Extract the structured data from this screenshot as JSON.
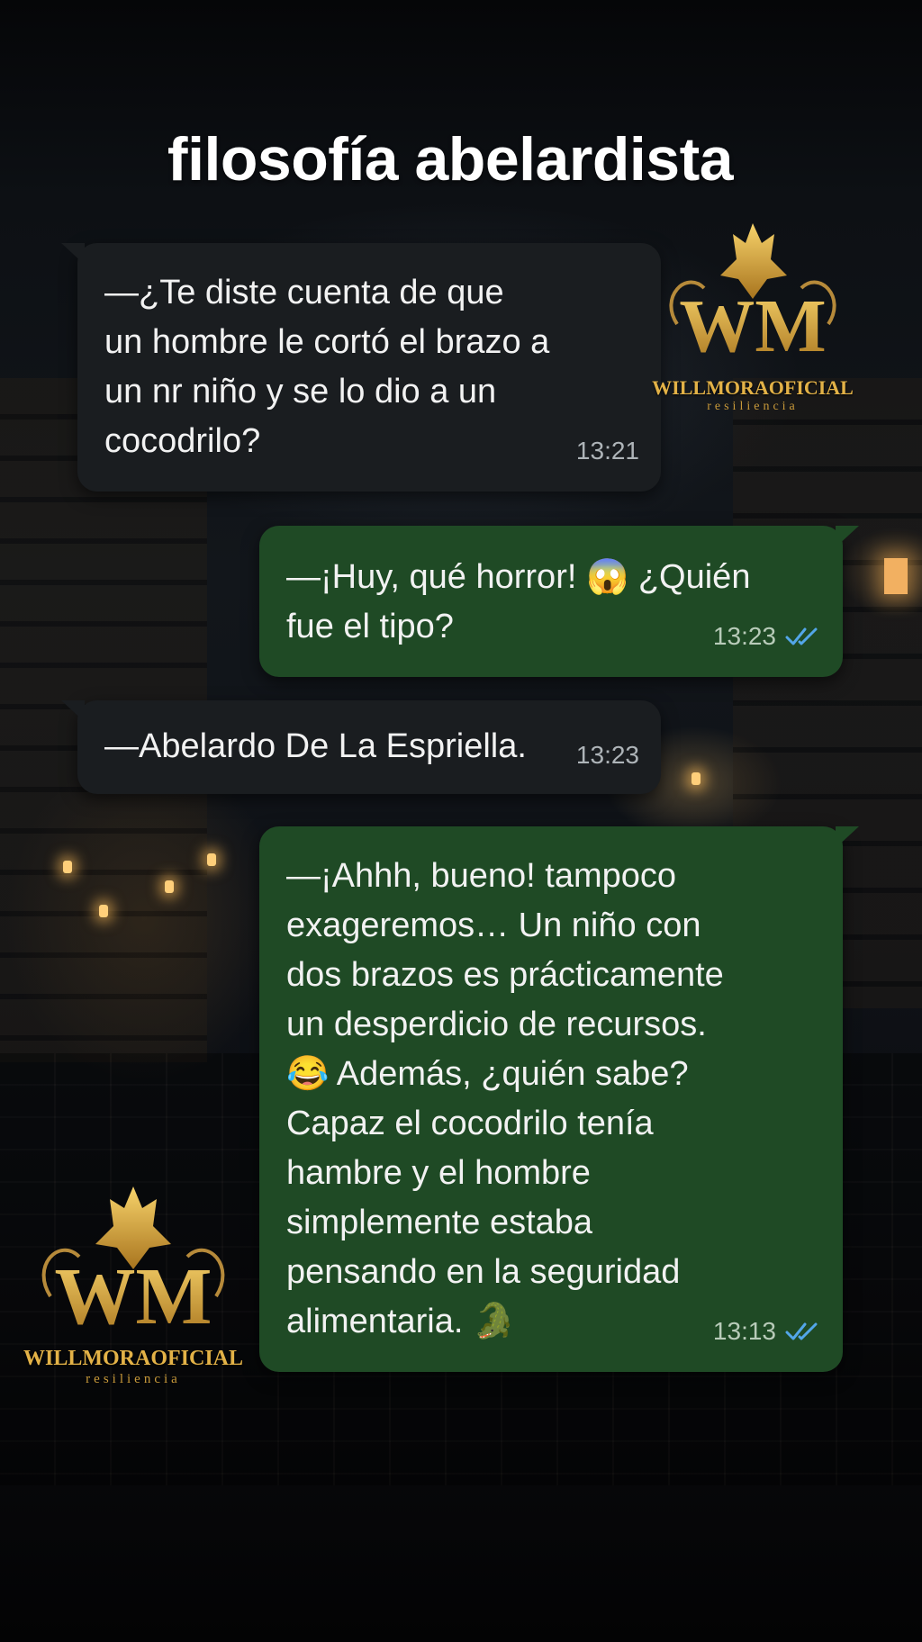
{
  "title": "filosofía abelardista",
  "messages": [
    {
      "direction": "incoming",
      "text": "—¿Te diste cuenta de que\nun hombre le cortó el brazo a\nun nr niño y se lo dio a un\ncocodrilo?",
      "time": "13:21"
    },
    {
      "direction": "outgoing",
      "text": "—¡Huy, qué horror! 😱 ¿Quién\nfue el tipo?",
      "time": "13:23",
      "status": "read"
    },
    {
      "direction": "incoming",
      "text": "—Abelardo De La Espriella.",
      "time": "13:23"
    },
    {
      "direction": "outgoing",
      "text": "—¡Ahhh, bueno! tampoco\nexageremos… Un niño con\ndos brazos es prácticamente\nun desperdicio de recursos.\n😂 Además, ¿quién sabe?\nCapaz el cocodrilo tenía\nhambre y el hombre\nsimplemente estaba\npensando en la seguridad\nalimentaria. 🐊",
      "time": "13:13",
      "status": "read"
    }
  ],
  "watermark": {
    "monogram": "WM",
    "name": "WILLMORAOFICIAL",
    "tagline": "resiliencia",
    "color": "#e3b247"
  },
  "colors": {
    "incoming_bubble": "#1a1d20",
    "outgoing_bubble": "#1f4a25",
    "read_ticks": "#53a6e8"
  }
}
